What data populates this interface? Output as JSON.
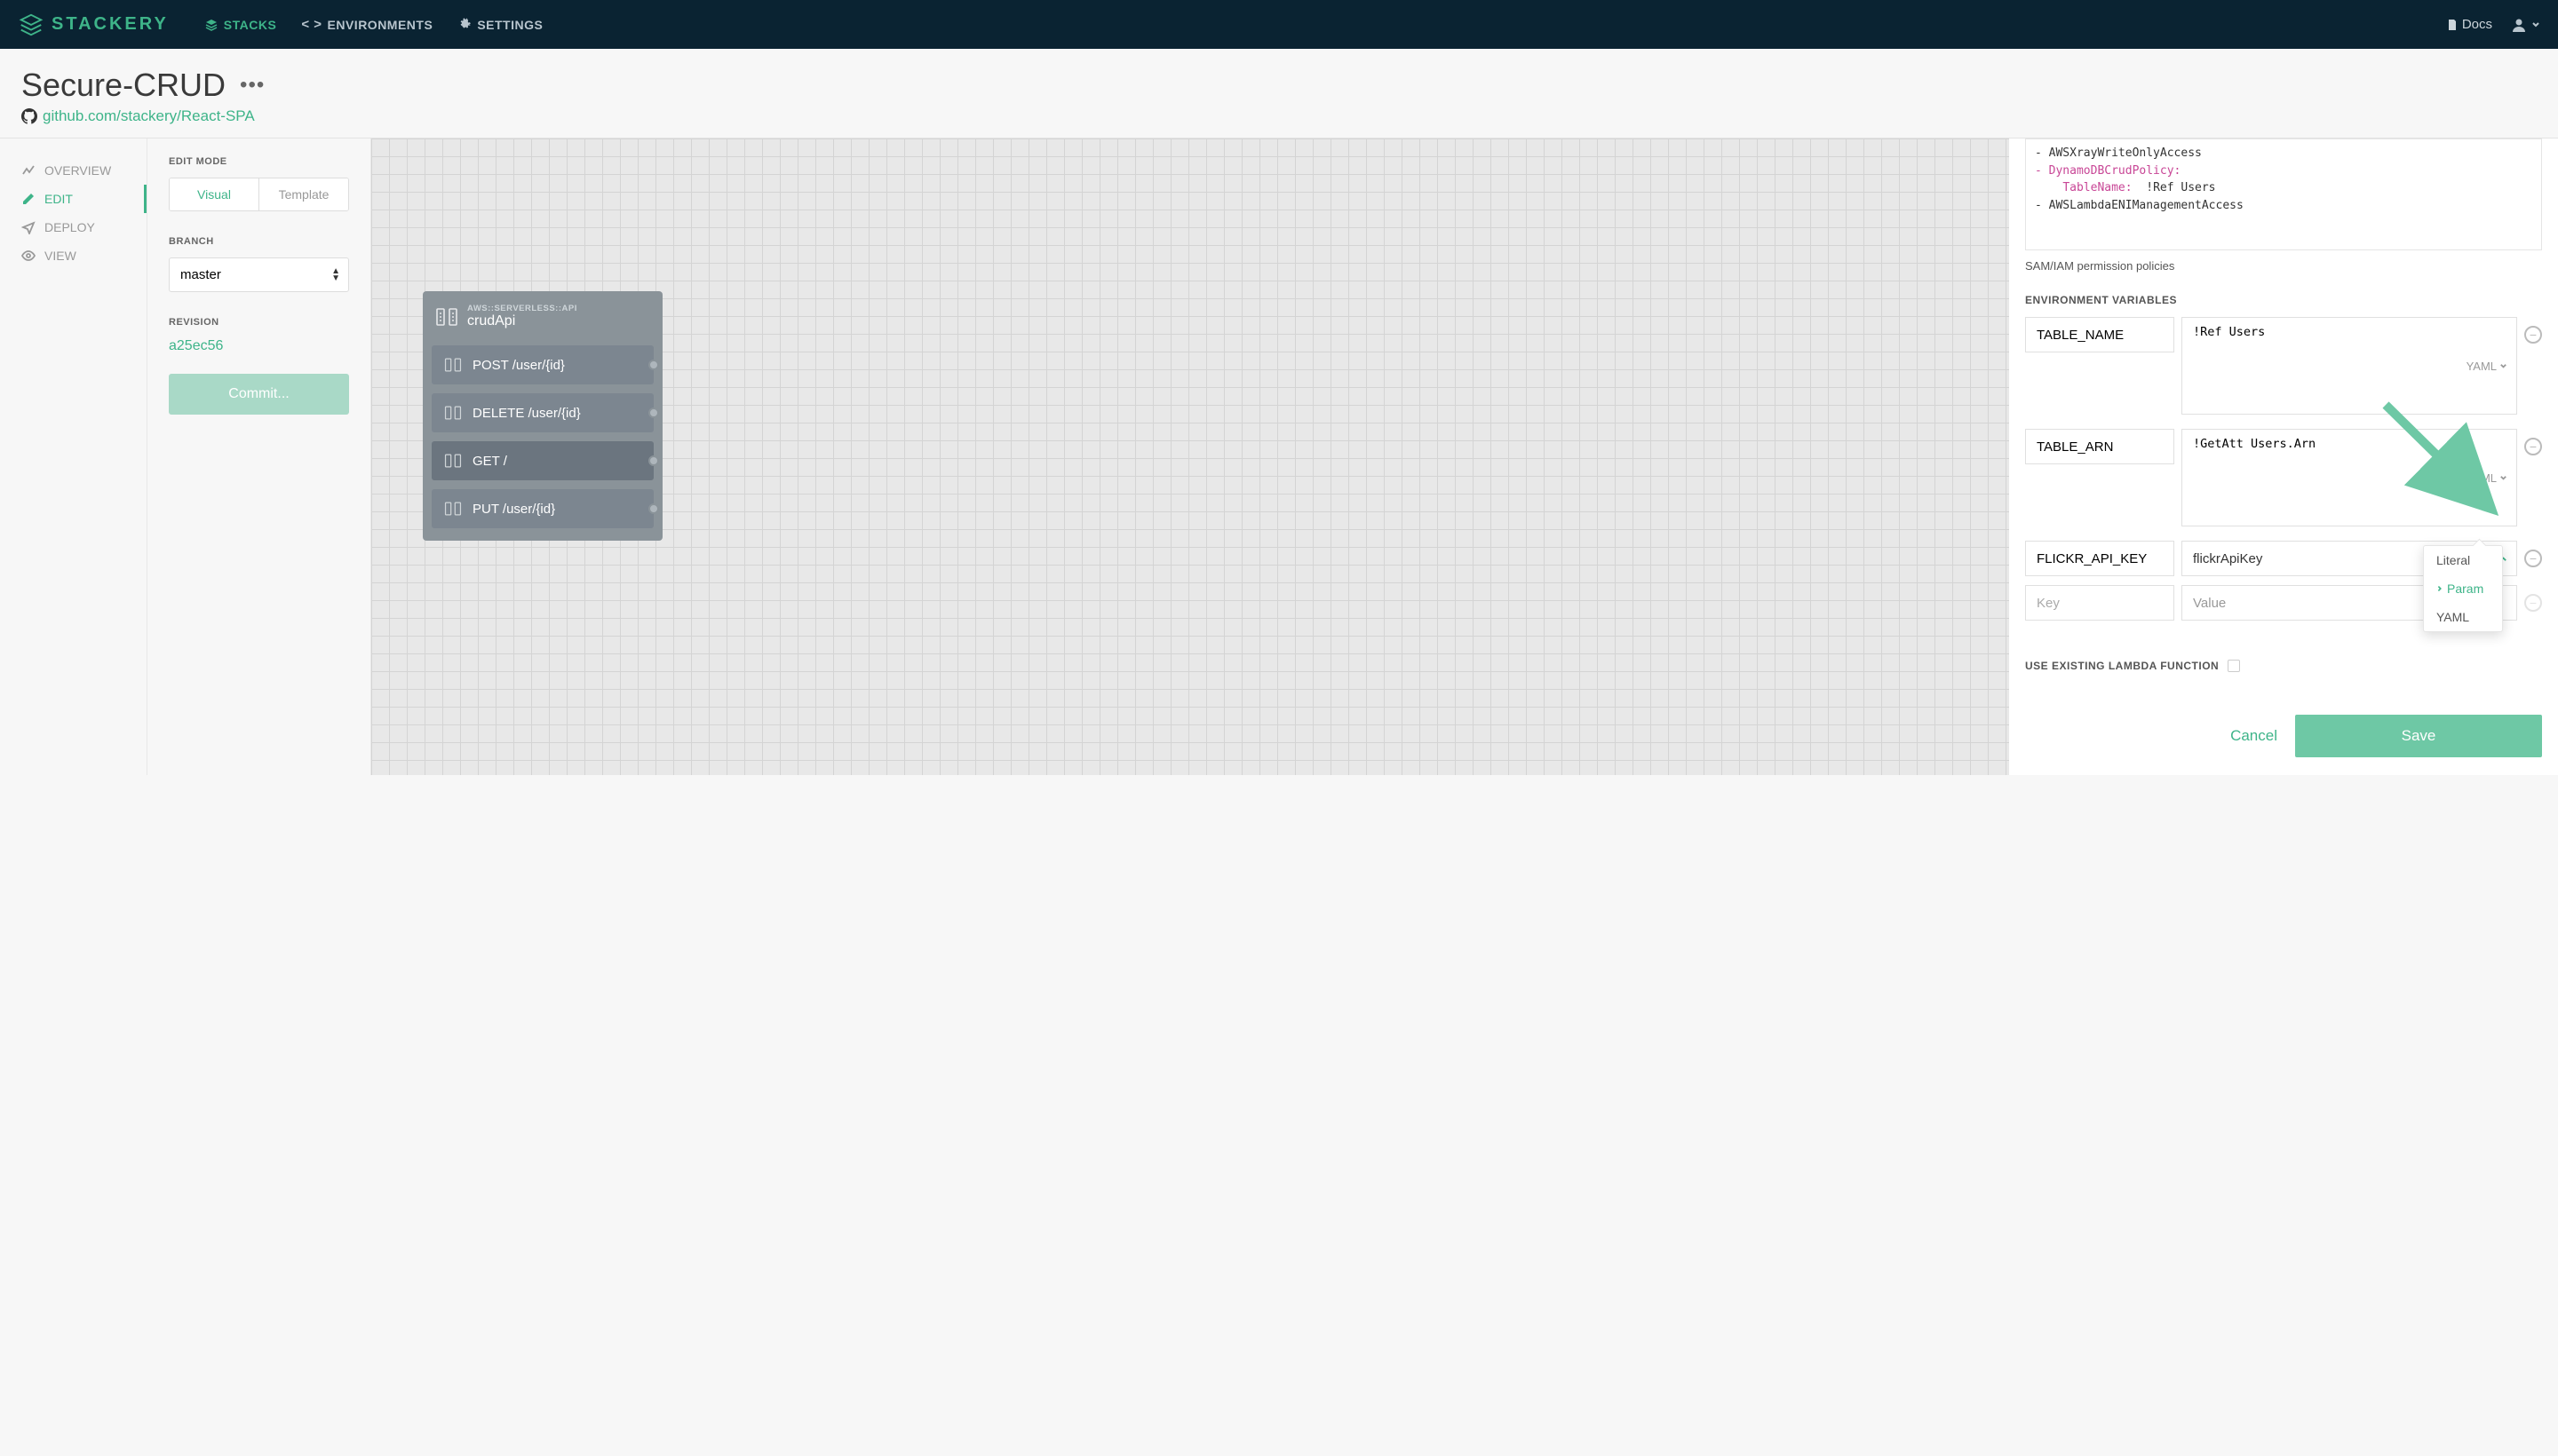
{
  "brand": "STACKERY",
  "topnav": {
    "stacks": "STACKS",
    "environments": "ENVIRONMENTS",
    "settings": "SETTINGS",
    "docs": "Docs"
  },
  "header": {
    "title": "Secure-CRUD",
    "repo_url": "github.com/stackery/React-SPA"
  },
  "sidenav": {
    "overview": "OVERVIEW",
    "edit": "EDIT",
    "deploy": "DEPLOY",
    "view": "VIEW"
  },
  "editpanel": {
    "edit_mode_label": "EDIT MODE",
    "visual": "Visual",
    "template": "Template",
    "branch_label": "BRANCH",
    "branch_value": "master",
    "revision_label": "REVISION",
    "revision_value": "a25ec56",
    "commit_label": "Commit..."
  },
  "api_card": {
    "type": "AWS::SERVERLESS::API",
    "name": "crudApi",
    "routes": [
      {
        "label": "POST /user/{id}",
        "active": false
      },
      {
        "label": "DELETE /user/{id}",
        "active": false
      },
      {
        "label": "GET /",
        "active": true
      },
      {
        "label": "PUT /user/{id}",
        "active": false
      }
    ]
  },
  "details": {
    "code_lines": {
      "l1a": "- ",
      "l1b": "AWSXrayWriteOnlyAccess",
      "l2a": "- ",
      "l2b": "DynamoDBCrudPolicy:",
      "l3a": "    TableName:",
      "l3b": "  !Ref Users",
      "l4a": "- ",
      "l4b": "AWSLambdaENIManagementAccess"
    },
    "policies_hint": "SAM/IAM permission policies",
    "env_label": "ENVIRONMENT VARIABLES",
    "env_vars": [
      {
        "key": "TABLE_NAME",
        "value": "!Ref Users",
        "type": "YAML"
      },
      {
        "key": "TABLE_ARN",
        "value": "!GetAtt Users.Arn",
        "type": "YAML"
      },
      {
        "key": "FLICKR_API_KEY",
        "value": "flickrApiKey",
        "type": "Param"
      }
    ],
    "empty_key_placeholder": "Key",
    "empty_value_placeholder": "Value",
    "dropdown": {
      "literal": "Literal",
      "param": "Param",
      "yaml": "YAML"
    },
    "use_existing_label": "USE EXISTING LAMBDA FUNCTION",
    "cancel": "Cancel",
    "save": "Save"
  }
}
